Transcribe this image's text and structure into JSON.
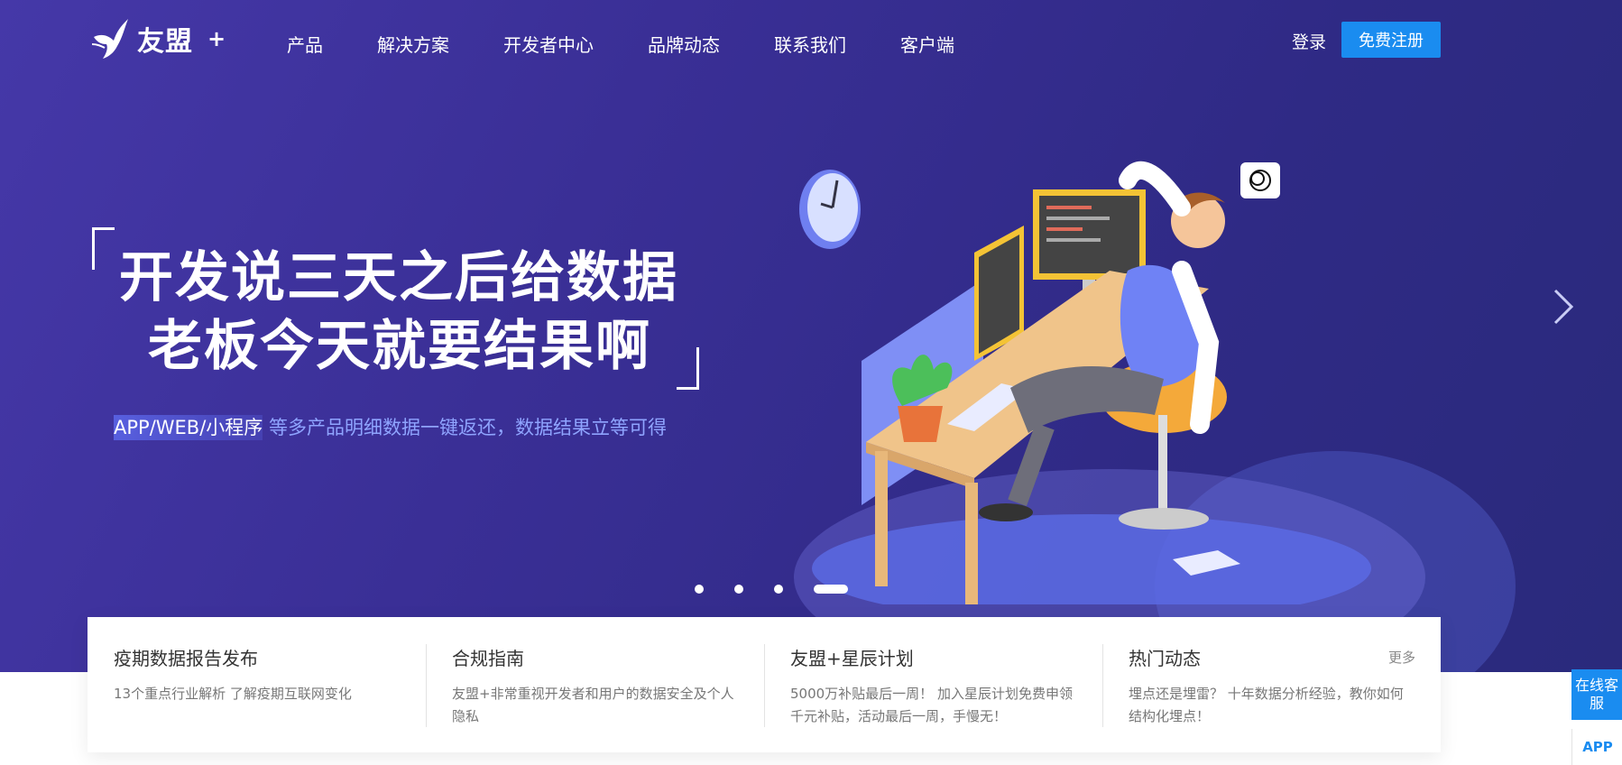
{
  "logo": {
    "text": "友盟",
    "plus": "+"
  },
  "nav": {
    "items": [
      "产品",
      "解决方案",
      "开发者中心",
      "品牌动态",
      "联系我们",
      "客户端"
    ]
  },
  "auth": {
    "login": "登录",
    "register": "免费注册"
  },
  "hero": {
    "headline_line1": "开发说三天之后给数据",
    "headline_line2": "老板今天就要结果啊",
    "sub_highlight": "APP/WEB/小程序",
    "sub_rest": "等多产品明细数据一键返还，数据结果立等可得",
    "carousel": {
      "slides": 4,
      "active_index": 3
    }
  },
  "news": [
    {
      "title": "疫期数据报告发布",
      "desc": "13个重点行业解析 了解疫期互联网变化"
    },
    {
      "title": "合规指南",
      "desc": "友盟+非常重视开发者和用户的数据安全及个人隐私"
    },
    {
      "title": "友盟+星辰计划",
      "desc": "5000万补贴最后一周！ 加入星辰计划免费申领千元补贴，活动最后一周，手慢无！"
    },
    {
      "title": "热门动态",
      "desc": "埋点还是埋雷？ 十年数据分析经验，教你如何结构化埋点！",
      "more": "更多"
    }
  ],
  "side": {
    "service": "在线客服",
    "app": "APP"
  },
  "colors": {
    "hero_bg": "#3a2f96",
    "accent": "#1a8cf0",
    "sub_text": "#8fa4ff"
  }
}
